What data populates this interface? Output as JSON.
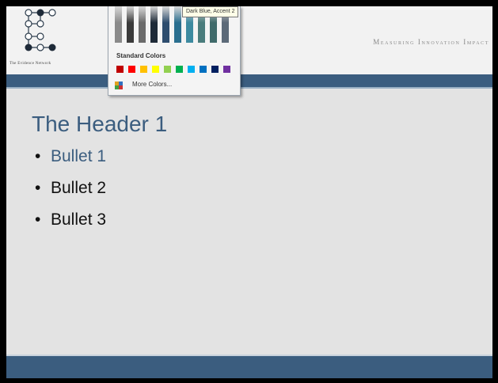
{
  "logo": {
    "org_name": "The Evidence Network"
  },
  "header": {
    "tagline": "Measuring Innovation Impact"
  },
  "slide": {
    "title": "The Header 1",
    "bullets": [
      "Bullet 1",
      "Bullet 2",
      "Bullet 3"
    ],
    "bullet_glyph": "•",
    "title_color": "#3b5d7f",
    "bar_color": "#3b5d7f"
  },
  "color_picker": {
    "tooltip": "Dark Blue, Accent 2",
    "standard_label": "Standard Colors",
    "more_colors_label": "More Colors...",
    "theme_shade_colors": [
      "#8a8a8a",
      "#3a3a3a",
      "#6b6b6b",
      "#1e2a38",
      "#2e4d6e",
      "#2a6f8f",
      "#3d8aa0",
      "#4a7c7c",
      "#3f6a6a",
      "#5c6a78"
    ],
    "standard_colors": [
      "#c00000",
      "#ff0000",
      "#ffc000",
      "#ffff00",
      "#92d050",
      "#00b050",
      "#00b0f0",
      "#0070c0",
      "#002060",
      "#7030a0"
    ]
  }
}
